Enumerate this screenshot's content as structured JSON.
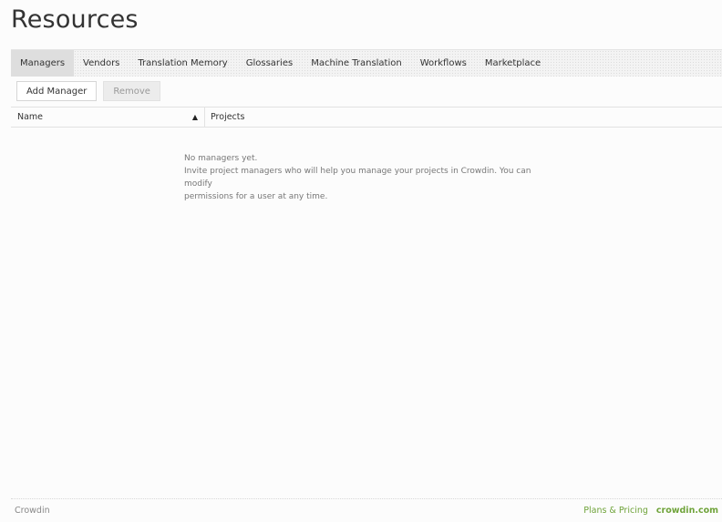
{
  "page": {
    "title": "Resources"
  },
  "tabs": [
    {
      "label": "Managers",
      "active": true
    },
    {
      "label": "Vendors"
    },
    {
      "label": "Translation Memory"
    },
    {
      "label": "Glossaries"
    },
    {
      "label": "Machine Translation"
    },
    {
      "label": "Workflows"
    },
    {
      "label": "Marketplace"
    }
  ],
  "toolbar": {
    "add_label": "Add Manager",
    "remove_label": "Remove"
  },
  "table": {
    "columns": [
      {
        "label": "Name",
        "sort": "ascending"
      },
      {
        "label": "Projects"
      }
    ],
    "sort_glyph": "▲"
  },
  "empty_state": {
    "title": "No managers yet.",
    "line1": "Invite project managers who will help you manage your projects in Crowdin. You can modify",
    "line2": "permissions for a user at any time."
  },
  "footer": {
    "left": "Crowdin",
    "plans": "Plans & Pricing",
    "brand": "crowdin.com"
  },
  "colors": {
    "accent": "#6fa33a",
    "active_tab": "#dedede"
  }
}
